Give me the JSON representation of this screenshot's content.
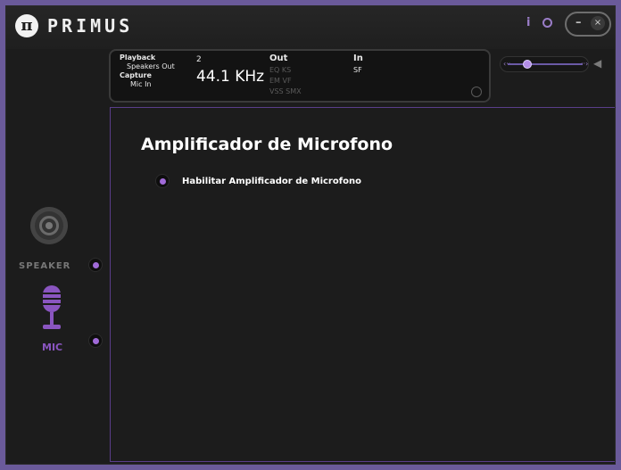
{
  "app": {
    "logo_glyph": "π",
    "name": "PRIMUS",
    "info_icon": "i",
    "minimize_glyph": "–",
    "close_glyph": "×"
  },
  "status": {
    "playback_label": "Playback",
    "playback_device": "Speakers Out",
    "channels": "2",
    "capture_label": "Capture",
    "capture_device": "Mic In",
    "sample_rate": "44.1 KHz",
    "out_label": "Out",
    "out_tags_row1": "EQ  KS",
    "out_tags_row2": "EM  VF",
    "out_tags_row3": "VSS SMX",
    "in_label": "In",
    "in_tag": "SF"
  },
  "volume": {
    "left_glyph": "‹··",
    "right_glyph": "··›",
    "level": 0.25,
    "icon": "speaker-volume-icon"
  },
  "sidebar": {
    "speaker_label": "SPEAKER",
    "mic_label": "MIC"
  },
  "main": {
    "title": "Amplificador de Microfono",
    "option_label": "Habilitar Amplificador de Microfono"
  },
  "colors": {
    "accent": "#a06ad8",
    "accent_dark": "#8a55c0",
    "background": "#1c1c1c"
  }
}
